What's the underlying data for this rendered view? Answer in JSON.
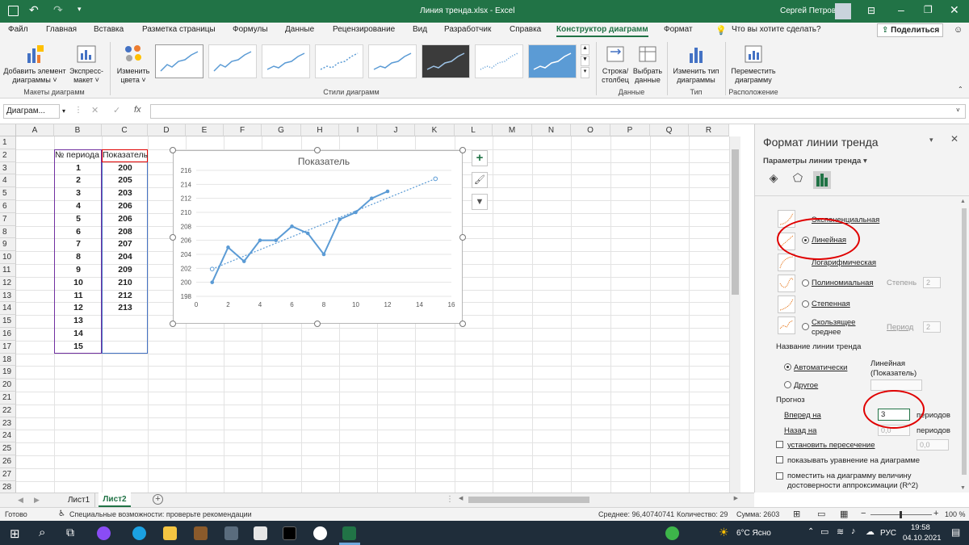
{
  "titlebar": {
    "doc_title": "Линия тренда.xlsx  -  Excel",
    "user": "Сергей Петров"
  },
  "tabs": [
    {
      "label": "Файл"
    },
    {
      "label": "Главная"
    },
    {
      "label": "Вставка"
    },
    {
      "label": "Разметка страницы"
    },
    {
      "label": "Формулы"
    },
    {
      "label": "Данные"
    },
    {
      "label": "Рецензирование"
    },
    {
      "label": "Вид"
    },
    {
      "label": "Разработчик"
    },
    {
      "label": "Справка"
    },
    {
      "label": "Конструктор диаграмм"
    },
    {
      "label": "Формат"
    }
  ],
  "tell_me": "Что вы хотите сделать?",
  "share": "Поделиться",
  "ribbon": {
    "add_element_1": "Добавить элемент",
    "add_element_2": "диаграммы ˅",
    "express_1": "Экспресс-",
    "express_2": "макет ˅",
    "change_colors_1": "Изменить",
    "change_colors_2": "цвета ˅",
    "group_layouts": "Макеты диаграмм",
    "group_styles": "Стили диаграмм",
    "row_col_1": "Строка/",
    "row_col_2": "столбец",
    "select_data_1": "Выбрать",
    "select_data_2": "данные",
    "group_data": "Данные",
    "change_type_1": "Изменить тип",
    "change_type_2": "диаграммы",
    "group_type": "Тип",
    "move_1": "Переместить",
    "move_2": "диаграмму",
    "group_location": "Расположение"
  },
  "formula_bar": {
    "name_box": "Диаграм...",
    "fx": "fx"
  },
  "columns": [
    "A",
    "B",
    "C",
    "D",
    "E",
    "F",
    "G",
    "H",
    "I",
    "J",
    "K",
    "L",
    "M",
    "N",
    "O",
    "P",
    "Q",
    "R"
  ],
  "rows": [
    "1",
    "2",
    "3",
    "4",
    "5",
    "6",
    "7",
    "8",
    "9",
    "10",
    "11",
    "12",
    "13",
    "14",
    "15",
    "16",
    "17",
    "18",
    "19",
    "20",
    "21",
    "22",
    "23",
    "24",
    "25",
    "26",
    "27",
    "28"
  ],
  "table": {
    "header_b": "№ периода",
    "header_c": "Показатель",
    "periods": [
      "1",
      "2",
      "3",
      "4",
      "5",
      "6",
      "7",
      "8",
      "9",
      "10",
      "11",
      "12",
      "13",
      "14",
      "15"
    ],
    "values": [
      "200",
      "205",
      "203",
      "206",
      "206",
      "208",
      "207",
      "204",
      "209",
      "210",
      "212",
      "213",
      "",
      "",
      ""
    ]
  },
  "chart_data": {
    "type": "scatter",
    "title": "Показатель",
    "x": [
      1,
      2,
      3,
      4,
      5,
      6,
      7,
      8,
      9,
      10,
      11,
      12
    ],
    "y": [
      200,
      205,
      203,
      206,
      206,
      208,
      207,
      204,
      209,
      210,
      212,
      213
    ],
    "trendline": {
      "type": "linear",
      "from_x": 1,
      "to_x": 15,
      "from_y": 201.9,
      "to_y": 214.8
    },
    "xlim": [
      0,
      16
    ],
    "ylim": [
      198,
      216
    ],
    "xticks": [
      "0",
      "2",
      "4",
      "6",
      "8",
      "10",
      "12",
      "14",
      "16"
    ],
    "yticks": [
      "198",
      "200",
      "202",
      "204",
      "206",
      "208",
      "210",
      "212",
      "214",
      "216"
    ],
    "grid": true,
    "series_color": "#5b9bd5"
  },
  "panel": {
    "title": "Формат линии тренда",
    "subtitle": "Параметры линии тренда",
    "opt_exp": "Экспоненциальная",
    "opt_linear": "Линейная",
    "opt_log": "Логарифмическая",
    "opt_poly": "Полиномиальная",
    "degree_label": "Степень",
    "degree_value": "2",
    "opt_power": "Степенная",
    "opt_ma_1": "Скользящее",
    "opt_ma_2": "среднее",
    "period_label": "Период",
    "period_value": "2",
    "trend_name": "Название линии тренда",
    "auto": "Автоматически",
    "auto_value_1": "Линейная",
    "auto_value_2": "(Показатель)",
    "other": "Другое",
    "forecast": "Прогноз",
    "forward": "Вперед на",
    "forward_value": "3",
    "periods_unit": "периодов",
    "backward": "Назад на",
    "backward_value": "0,0",
    "intercept": "установить пересечение",
    "intercept_value": "0,0",
    "show_equation": "показывать уравнение на диаграмме",
    "show_r2_1": "поместить на диаграмму величину",
    "show_r2_2": "достоверности аппроксимации (R^2)"
  },
  "sheets": [
    "Лист1",
    "Лист2"
  ],
  "status": {
    "ready": "Готово",
    "accessibility": "Специальные возможности: проверьте рекомендации",
    "average": "Среднее: 96,40740741",
    "count": "Количество: 29",
    "sum": "Сумма: 2603",
    "zoom": "100 %"
  },
  "taskbar": {
    "weather": "6°C  Ясно",
    "lang": "РУС",
    "time": "19:58",
    "date": "04.10.2021"
  },
  "colors": {
    "excel_green": "#217346",
    "annotation_red": "#e00000"
  }
}
